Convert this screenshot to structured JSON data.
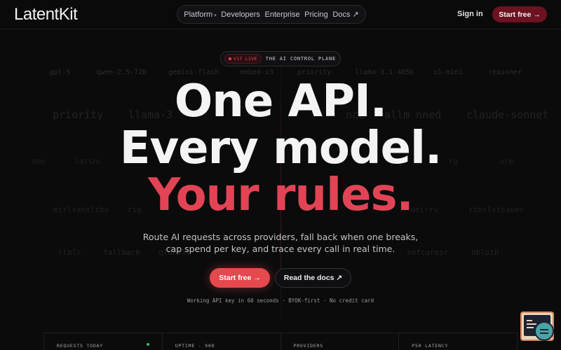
{
  "header": {
    "logo": "LatentKit",
    "nav": [
      {
        "label": "Platform",
        "has_dropdown": true
      },
      {
        "label": "Developers"
      },
      {
        "label": "Enterprise"
      },
      {
        "label": "Pricing"
      },
      {
        "label": "Docs ↗"
      }
    ],
    "sign_in": "Sign in",
    "start_free": "Start free →"
  },
  "background_models": {
    "row1": [
      "gpt-5",
      "qwen-2.5-72b",
      "gemini-flash",
      "embed-v3",
      "priority",
      "llama-3.1-405b",
      "o1-mini",
      "reasoner"
    ],
    "row2": [
      "priority",
      "llama-3",
      "nce",
      "allm nned",
      "claude-sonnet"
    ],
    "row3": [
      "smn",
      "latsnc",
      "rg",
      "ure"
    ],
    "row4": [
      "eirlsantlcbo",
      "rig",
      "ueir",
      "ru",
      "rtnrlstsauer"
    ],
    "row5": [
      "rlblr",
      "fallback",
      "qlunslo",
      "snfcuresr",
      "nbloth"
    ]
  },
  "badge": {
    "pill": "V17 LIVE",
    "text": "THE AI CONTROL PLANE"
  },
  "hero": {
    "line1": "One API.",
    "line2": "Every model.",
    "line3": "Your rules.",
    "subtitle": "Route AI requests across providers, fall back when one breaks, cap spend per key, and trace every call in real time.",
    "primary_cta": "Start free →",
    "secondary_cta": "Read the docs ↗",
    "fine_print": "Working API key in 60 seconds · BYOK-first · No credit card"
  },
  "stats": [
    {
      "label": "REQUESTS TODAY"
    },
    {
      "label": "UPTIME · 90D"
    },
    {
      "label": "PROVIDERS"
    },
    {
      "label": "P50 LATENCY"
    }
  ],
  "colors": {
    "accent": "#e5484d",
    "accent_dark": "#6d1220",
    "background": "#0b0b0c",
    "live": "#2fbf71"
  }
}
